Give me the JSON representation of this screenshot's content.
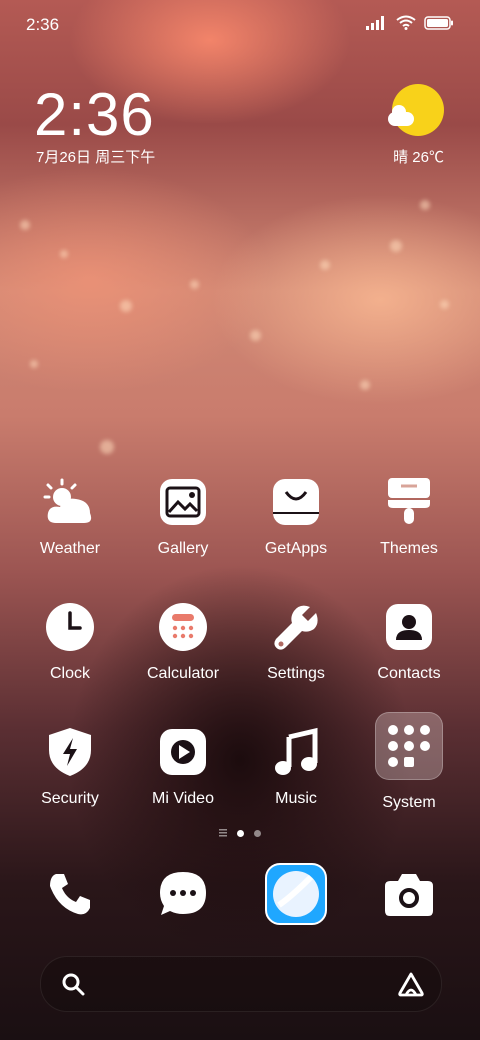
{
  "status_bar": {
    "time": "2:36",
    "icons": [
      "signal-icon",
      "wifi-icon",
      "battery-icon"
    ]
  },
  "clock_widget": {
    "time": "2:36",
    "date": "7月26日 周三下午"
  },
  "weather_widget": {
    "text": "晴 26℃",
    "icon": "sunny-cloud-icon",
    "sun_color": "#f8d21a"
  },
  "apps": [
    {
      "label": "Weather",
      "icon": "weather-icon"
    },
    {
      "label": "Gallery",
      "icon": "gallery-icon"
    },
    {
      "label": "GetApps",
      "icon": "getapps-icon"
    },
    {
      "label": "Themes",
      "icon": "themes-icon"
    },
    {
      "label": "Clock",
      "icon": "clock-icon"
    },
    {
      "label": "Calculator",
      "icon": "calculator-icon"
    },
    {
      "label": "Settings",
      "icon": "settings-icon"
    },
    {
      "label": "Contacts",
      "icon": "contacts-icon"
    },
    {
      "label": "Security",
      "icon": "security-icon"
    },
    {
      "label": "Mi Video",
      "icon": "mi-video-icon"
    },
    {
      "label": "Music",
      "icon": "music-icon"
    },
    {
      "label": "System",
      "icon": "system-folder-icon"
    }
  ],
  "page_indicator": {
    "pages": 2,
    "current": 1
  },
  "dock": [
    {
      "icon": "phone-icon"
    },
    {
      "icon": "messages-icon"
    },
    {
      "icon": "browser-icon",
      "color": "#1fa7ff"
    },
    {
      "icon": "camera-icon"
    }
  ],
  "search_bar": {
    "left_icon": "search-icon",
    "right_icon": "assistant-icon"
  }
}
